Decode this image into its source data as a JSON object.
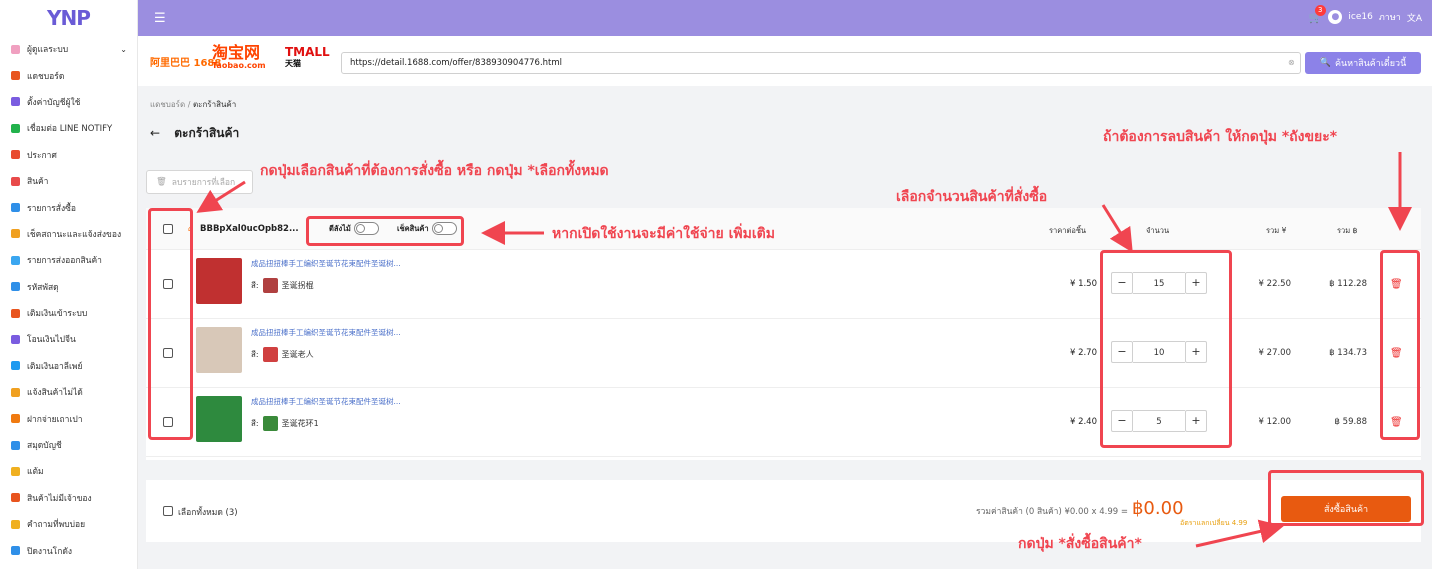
{
  "app": {
    "logo": "YNP"
  },
  "sidebar": {
    "items": [
      {
        "label": "ผู้ดูแลระบบ",
        "color": "#f0a0c0",
        "chev": "⌄"
      },
      {
        "label": "แดชบอร์ด",
        "color": "#e8541e"
      },
      {
        "label": "ตั้งค่าบัญชีผู้ใช้",
        "color": "#7a5ce0"
      },
      {
        "label": "เชื่อมต่อ LINE NOTIFY",
        "color": "#22b24c"
      },
      {
        "label": "ประกาศ",
        "color": "#e84a2e"
      },
      {
        "label": "สินค้า",
        "color": "#e84a4a"
      },
      {
        "label": "รายการสั่งซื้อ",
        "color": "#2f8fe8"
      },
      {
        "label": "เช็คสถานะและแจ้งส่งของ",
        "color": "#f0a020"
      },
      {
        "label": "รายการส่งออกสินค้า",
        "color": "#3aa6f0"
      },
      {
        "label": "รหัสพัสดุ",
        "color": "#2f8fe8"
      },
      {
        "label": "เติมเงินเข้าระบบ",
        "color": "#e8541e"
      },
      {
        "label": "โอนเงินไปจีน",
        "color": "#7a5ce0"
      },
      {
        "label": "เติมเงินอาลีเพย์",
        "color": "#1e9af0"
      },
      {
        "label": "แจ้งสินค้าไม่ได้",
        "color": "#f0a020"
      },
      {
        "label": "ฝากจ่ายเถาเปา",
        "color": "#f07a10"
      },
      {
        "label": "สมุดบัญชี",
        "color": "#2f8fe8"
      },
      {
        "label": "แต้ม",
        "color": "#f0b020"
      },
      {
        "label": "สินค้าไม่มีเจ้าของ",
        "color": "#e8541e"
      },
      {
        "label": "คำถามที่พบบ่อย",
        "color": "#f0b020"
      },
      {
        "label": "ปิดงานโกดัง",
        "color": "#2f8fe8"
      }
    ]
  },
  "topbar": {
    "menu_icon": "☰",
    "cart_icon": "🛒",
    "cart_count": "3",
    "avatar_icon": "user-icon",
    "username": "ice16",
    "lang": "ภาษา",
    "lang_icon": "文A"
  },
  "search": {
    "brand_1688": "阿里巴巴 1688",
    "brand_taobao": "淘宝网",
    "brand_taobao_sub": "Taobao.com",
    "brand_tmall": "TMALL",
    "brand_tmall_sub": "天猫",
    "url": "https://detail.1688.com/offer/838930904776.html",
    "clear_icon": "⊗",
    "button_label": "ค้นหาสินค้าเดี๋ยวนี้",
    "button_icon": "🔍"
  },
  "breadcrumb": {
    "home": "แดชบอร์ด",
    "sep": "/",
    "current": "ตะกร้าสินค้า"
  },
  "page_title": "ตะกร้าสินค้า",
  "back_icon": "←",
  "delete_selected": {
    "icon": "🗑",
    "label": "ลบรายการที่เลือก"
  },
  "cart": {
    "shop_name": "BBBpXal0ucOpb82...",
    "toggle_qc": "ตีลังไม้",
    "toggle_check": "เช็คสินค้า",
    "headers": {
      "price": "ราคาต่อชิ้น",
      "qty": "จำนวน",
      "total_yuan": "รวม ¥",
      "total_baht": "รวม ฿"
    },
    "items": [
      {
        "name": "成品扭扭棒手工编织圣诞节花束配件圣诞树...",
        "variant_label": "สี:",
        "variant": "圣诞拐棍",
        "price": "¥ 1.50",
        "qty": "15",
        "total_yuan": "¥ 22.50",
        "total_baht": "฿ 112.28",
        "thumb_color": "#c03030",
        "swatch_color": "#b04040"
      },
      {
        "name": "成品扭扭棒手工编织圣诞节花束配件圣诞树...",
        "variant_label": "สี:",
        "variant": "圣诞老人",
        "price": "¥ 2.70",
        "qty": "10",
        "total_yuan": "¥ 27.00",
        "total_baht": "฿ 134.73",
        "thumb_color": "#d8c8b8",
        "swatch_color": "#d04040"
      },
      {
        "name": "成品扭扭棒手工编织圣诞节花束配件圣诞树...",
        "variant_label": "สี:",
        "variant": "圣诞花环1",
        "price": "¥ 2.40",
        "qty": "5",
        "total_yuan": "¥ 12.00",
        "total_baht": "฿ 59.88",
        "thumb_color": "#2e8a3e",
        "swatch_color": "#3a8a3a"
      }
    ],
    "minus": "−",
    "plus": "+",
    "delete_icon": "🗑"
  },
  "footer": {
    "select_all": "เลือกทั้งหมด (3)",
    "sum_text": "รวมค่าสินค้า (0 สินค้า) ¥0.00 x 4.99 =",
    "sum_total": "฿0.00",
    "rate": "อัตราแลกเปลี่ยน 4.99",
    "buy_button": "สั่งซื้อสินค้า"
  },
  "annotations": {
    "select": "กดปุ่มเลือกสินค้าที่ต้องการสั่งซื้อ หรือ กดปุ่ม *เลือกทั้งหมด",
    "toggles": "หากเปิดใช้งานจะมีค่าใช้จ่าย เพิ่มเติม",
    "qty": "เลือกจำนวนสินค้าที่สั่งซื้อ",
    "delete": "ถ้าต้องการลบสินค้า ให้กดปุ่ม *ถังขยะ*",
    "buy": "กดปุ่ม *สั่งซื้อสินค้า*",
    "color": "#f04550"
  }
}
